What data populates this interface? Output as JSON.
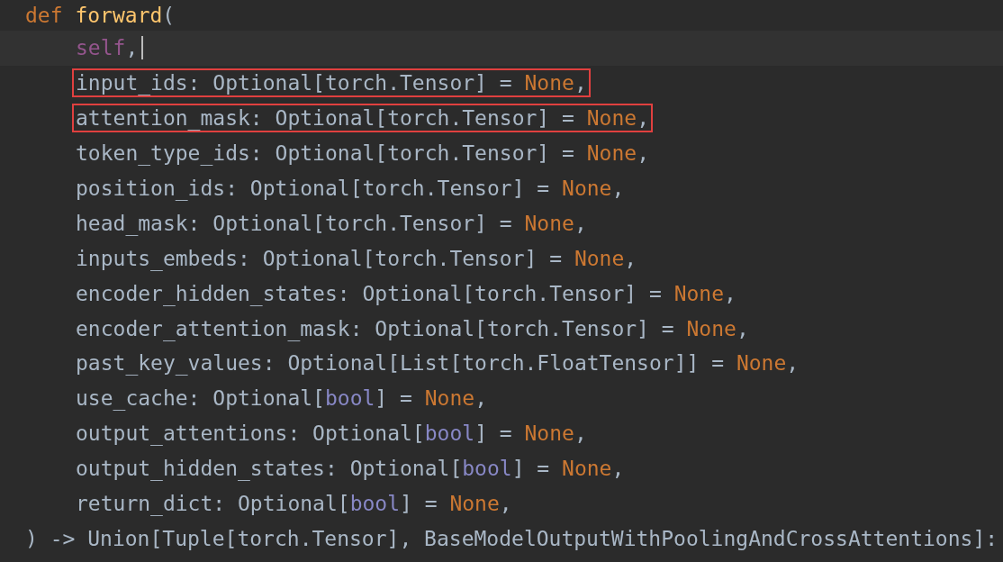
{
  "editor": {
    "header": {
      "tokens": [
        {
          "kind": "keyword",
          "text": "def"
        },
        {
          "kind": "function",
          "text": "forward"
        },
        {
          "kind": "plain",
          "text": "("
        }
      ]
    },
    "children": [
      {
        "tokens": [
          {
            "kind": "self",
            "text": "self"
          },
          {
            "kind": "plain",
            "text": ","
          }
        ],
        "cursor": true,
        "boxed": false
      },
      {
        "tokens": [
          {
            "kind": "plain",
            "text": "input_ids: Optional[torch.Tensor] = "
          },
          {
            "kind": "keyword",
            "text": "None"
          },
          {
            "kind": "plain",
            "text": ","
          }
        ],
        "cursor": false,
        "boxed": true
      },
      {
        "tokens": [
          {
            "kind": "plain",
            "text": "attention_mask: Optional[torch.Tensor] = "
          },
          {
            "kind": "keyword",
            "text": "None"
          },
          {
            "kind": "plain",
            "text": ","
          }
        ],
        "cursor": false,
        "boxed": true
      },
      {
        "tokens": [
          {
            "kind": "plain",
            "text": "token_type_ids: Optional[torch.Tensor] = "
          },
          {
            "kind": "keyword",
            "text": "None"
          },
          {
            "kind": "plain",
            "text": ","
          }
        ],
        "cursor": false,
        "boxed": false
      },
      {
        "tokens": [
          {
            "kind": "plain",
            "text": "position_ids: Optional[torch.Tensor] = "
          },
          {
            "kind": "keyword",
            "text": "None"
          },
          {
            "kind": "plain",
            "text": ","
          }
        ],
        "cursor": false,
        "boxed": false
      },
      {
        "tokens": [
          {
            "kind": "plain",
            "text": "head_mask: Optional[torch.Tensor] = "
          },
          {
            "kind": "keyword",
            "text": "None"
          },
          {
            "kind": "plain",
            "text": ","
          }
        ],
        "cursor": false,
        "boxed": false
      },
      {
        "tokens": [
          {
            "kind": "plain",
            "text": "inputs_embeds: Optional[torch.Tensor] = "
          },
          {
            "kind": "keyword",
            "text": "None"
          },
          {
            "kind": "plain",
            "text": ","
          }
        ],
        "cursor": false,
        "boxed": false
      },
      {
        "tokens": [
          {
            "kind": "plain",
            "text": "encoder_hidden_states: Optional[torch.Tensor] = "
          },
          {
            "kind": "keyword",
            "text": "None"
          },
          {
            "kind": "plain",
            "text": ","
          }
        ],
        "cursor": false,
        "boxed": false
      },
      {
        "tokens": [
          {
            "kind": "plain",
            "text": "encoder_attention_mask: Optional[torch.Tensor] = "
          },
          {
            "kind": "keyword",
            "text": "None"
          },
          {
            "kind": "plain",
            "text": ","
          }
        ],
        "cursor": false,
        "boxed": false
      },
      {
        "tokens": [
          {
            "kind": "plain",
            "text": "past_key_values: Optional[List[torch.FloatTensor]] = "
          },
          {
            "kind": "keyword",
            "text": "None"
          },
          {
            "kind": "plain",
            "text": ","
          }
        ],
        "cursor": false,
        "boxed": false
      },
      {
        "tokens": [
          {
            "kind": "plain",
            "text": "use_cache: Optional["
          },
          {
            "kind": "builtin",
            "text": "bool"
          },
          {
            "kind": "plain",
            "text": "] = "
          },
          {
            "kind": "keyword",
            "text": "None"
          },
          {
            "kind": "plain",
            "text": ","
          }
        ],
        "cursor": false,
        "boxed": false
      },
      {
        "tokens": [
          {
            "kind": "plain",
            "text": "output_attentions: Optional["
          },
          {
            "kind": "builtin",
            "text": "bool"
          },
          {
            "kind": "plain",
            "text": "] = "
          },
          {
            "kind": "keyword",
            "text": "None"
          },
          {
            "kind": "plain",
            "text": ","
          }
        ],
        "cursor": false,
        "boxed": false
      },
      {
        "tokens": [
          {
            "kind": "plain",
            "text": "output_hidden_states: Optional["
          },
          {
            "kind": "builtin",
            "text": "bool"
          },
          {
            "kind": "plain",
            "text": "] = "
          },
          {
            "kind": "keyword",
            "text": "None"
          },
          {
            "kind": "plain",
            "text": ","
          }
        ],
        "cursor": false,
        "boxed": false
      },
      {
        "tokens": [
          {
            "kind": "plain",
            "text": "return_dict: Optional["
          },
          {
            "kind": "builtin",
            "text": "bool"
          },
          {
            "kind": "plain",
            "text": "] = "
          },
          {
            "kind": "keyword",
            "text": "None"
          },
          {
            "kind": "plain",
            "text": ","
          }
        ],
        "cursor": false,
        "boxed": false
      }
    ],
    "footer": {
      "tokens": [
        {
          "kind": "plain",
          "text": ") -> Union[Tuple[torch.Tensor], BaseModelOutputWithPoolingAndCrossAttentions]:"
        }
      ]
    }
  }
}
